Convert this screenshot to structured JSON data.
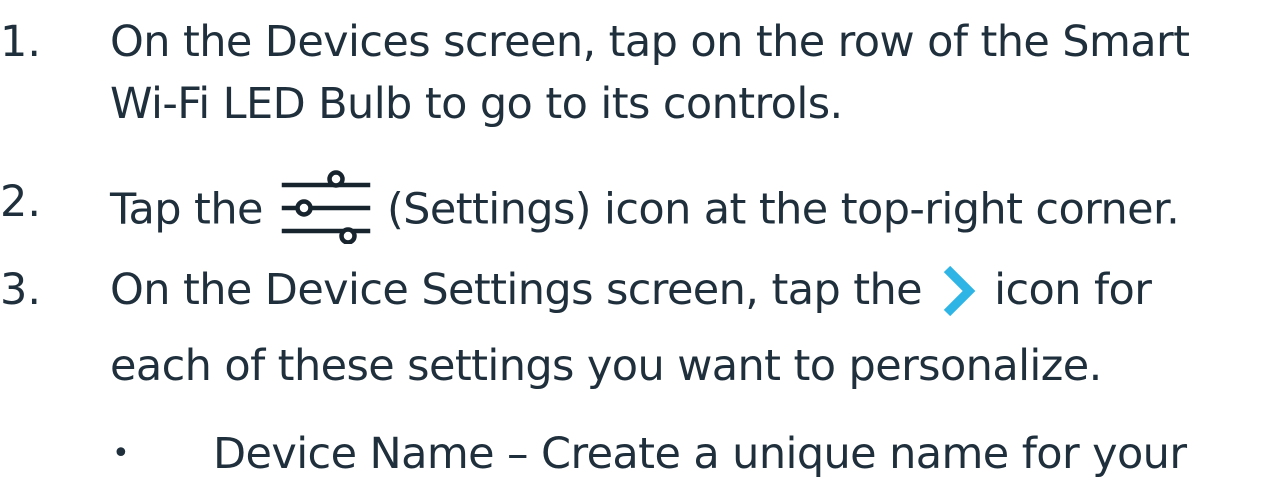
{
  "steps": [
    {
      "number": "1.",
      "lines": [
        "On the Devices screen, tap on the row of the Smart",
        "Wi-Fi LED Bulb to go to its controls."
      ]
    },
    {
      "number": "2.",
      "before_icon": "Tap the",
      "icon": "settings-sliders-icon",
      "after_icon": "(Settings) icon at the top-right corner."
    },
    {
      "number": "3.",
      "line1_before_icon": "On the Device Settings screen, tap the",
      "icon": "chevron-right-icon",
      "line1_after_icon": "icon for",
      "line2": "each of these settings you want to personalize."
    }
  ],
  "bullets": [
    {
      "marker": "•",
      "text": "Device Name – Create a unique name for your"
    }
  ],
  "colors": {
    "text": "#1f2f3c",
    "icon_dark": "#17232d",
    "chevron": "#2fb4e6"
  }
}
